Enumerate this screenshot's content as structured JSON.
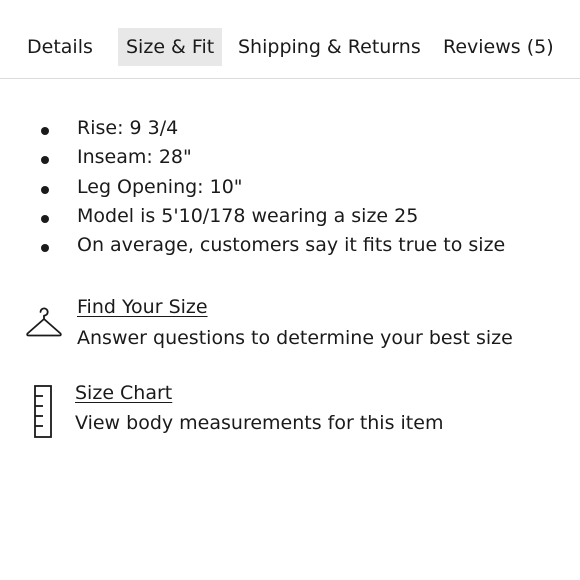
{
  "tabs": [
    {
      "label": "Details",
      "active": false
    },
    {
      "label": "Size & Fit",
      "active": true
    },
    {
      "label": "Shipping & Returns",
      "active": false
    },
    {
      "label": "Reviews (5)",
      "active": false
    }
  ],
  "size_fit": {
    "bullets": [
      "Rise: 9 3/4",
      "Inseam: 28\"",
      "Leg Opening: 10\"",
      "Model is 5'10/178 wearing a size 25",
      "On average, customers say it fits true to size"
    ],
    "find_your_size": {
      "icon": "hanger-icon",
      "link_label": "Find Your Size",
      "description": "Answer questions to determine your best size"
    },
    "size_chart": {
      "icon": "ruler-icon",
      "link_label": "Size Chart",
      "description": "View body measurements for this item"
    }
  },
  "colors": {
    "text": "#1a1a1a",
    "active_tab_bg": "#e8e8e8",
    "divider": "#dcdcdc"
  }
}
